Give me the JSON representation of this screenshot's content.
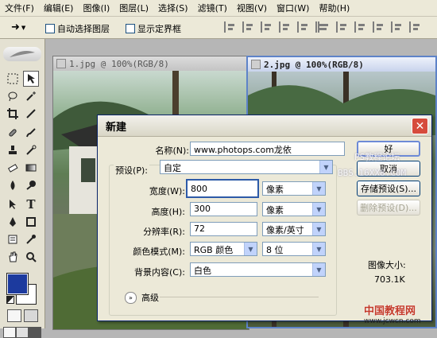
{
  "menu": [
    "文件(F)",
    "编辑(E)",
    "图像(I)",
    "图层(L)",
    "选择(S)",
    "滤镜(T)",
    "视图(V)",
    "窗口(W)",
    "帮助(H)"
  ],
  "options": {
    "auto_select": "自动选择图层",
    "show_bounds": "显示定界框"
  },
  "documents": [
    {
      "title": "1.jpg @ 100%(RGB/8)"
    },
    {
      "title": "2.jpg @ 100%(RGB/8)"
    }
  ],
  "dialog": {
    "title": "新建",
    "name_label": "名称(N):",
    "name_value": "www.photops.com龙依",
    "preset_label": "预设(P):",
    "preset_value": "自定",
    "width_label": "宽度(W):",
    "width_value": "800",
    "width_unit": "像素",
    "height_label": "高度(H):",
    "height_value": "300",
    "height_unit": "像素",
    "resolution_label": "分辨率(R):",
    "resolution_value": "72",
    "resolution_unit": "像素/英寸",
    "color_mode_label": "颜色模式(M):",
    "color_mode_value": "RGB 颜色",
    "bit_depth_value": "8 位",
    "background_label": "背景内容(C):",
    "background_value": "白色",
    "advanced_label": "高级",
    "ok_label": "好",
    "cancel_label": "取消",
    "save_preset_label": "存储预设(S)...",
    "delete_preset_label": "删除预设(D)...",
    "image_size_label": "图像大小:",
    "image_size_value": "703.1K"
  },
  "watermarks": {
    "line1": "PS教程论坛",
    "line2": "BBS.16XX8.COM",
    "bottom_logo": "中国教程网",
    "bottom_url": "www.jcwcn.com"
  },
  "colors": {
    "foreground": "#1c3a9e",
    "background": "#ffffff",
    "accent": "#0a246a"
  }
}
